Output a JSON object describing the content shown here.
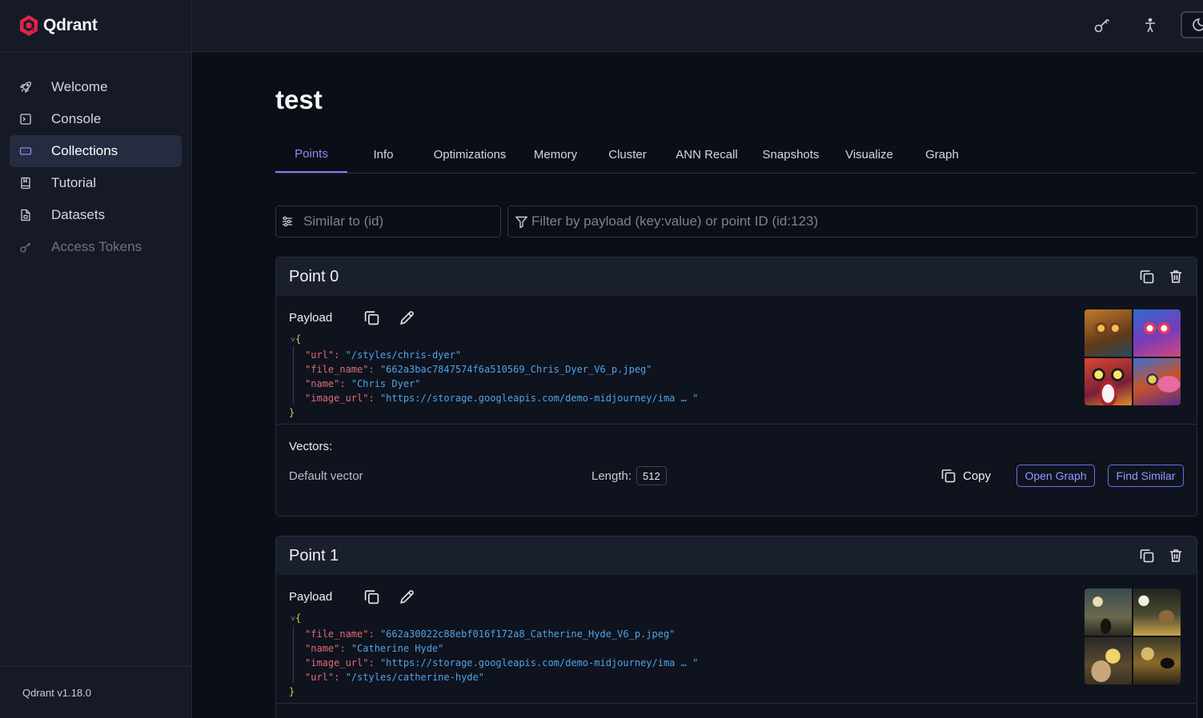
{
  "app": {
    "name": "Qdrant",
    "version": "Qdrant v1.18.0"
  },
  "sidebar": {
    "items": [
      {
        "label": "Welcome",
        "icon": "rocket-icon",
        "state": "normal"
      },
      {
        "label": "Console",
        "icon": "terminal-icon",
        "state": "normal"
      },
      {
        "label": "Collections",
        "icon": "collections-icon",
        "state": "active"
      },
      {
        "label": "Tutorial",
        "icon": "book-icon",
        "state": "normal"
      },
      {
        "label": "Datasets",
        "icon": "file-icon",
        "state": "normal"
      },
      {
        "label": "Access Tokens",
        "icon": "key-icon",
        "state": "disabled"
      }
    ]
  },
  "header": {
    "icons": [
      "key-icon",
      "accessibility-icon",
      "theme-toggle-icon"
    ]
  },
  "page": {
    "title": "test"
  },
  "tabs": [
    "Points",
    "Info",
    "Optimizations",
    "Memory",
    "Cluster",
    "ANN Recall",
    "Snapshots",
    "Visualize",
    "Graph"
  ],
  "active_tab": "Points",
  "search": {
    "similar_placeholder": "Similar to (id)",
    "filter_placeholder": "Filter by payload (key:value) or point ID (id:123)"
  },
  "labels": {
    "payload": "Payload",
    "vectors": "Vectors:",
    "default_vector": "Default vector",
    "length": "Length:",
    "copy": "Copy",
    "open_graph": "Open Graph",
    "find_similar": "Find Similar"
  },
  "points": [
    {
      "title": "Point 0",
      "payload": [
        {
          "key": "\"url\"",
          "value": "\"/styles/chris-dyer\""
        },
        {
          "key": "\"file_name\"",
          "value": "\"662a3bac7847574f6a510569_Chris_Dyer_V6_p.jpeg\""
        },
        {
          "key": "\"name\"",
          "value": "\"Chris Dyer\""
        },
        {
          "key": "\"image_url\"",
          "value": "\"https://storage.googleapis.com/demo-midjourney/ima … \""
        }
      ],
      "vector_length": "512"
    },
    {
      "title": "Point 1",
      "payload": [
        {
          "key": "\"file_name\"",
          "value": "\"662a30022c88ebf016f172a8_Catherine_Hyde_V6_p.jpeg\""
        },
        {
          "key": "\"name\"",
          "value": "\"Catherine Hyde\""
        },
        {
          "key": "\"image_url\"",
          "value": "\"https://storage.googleapis.com/demo-midjourney/ima … \""
        },
        {
          "key": "\"url\"",
          "value": "\"/styles/catherine-hyde\""
        }
      ]
    }
  ],
  "json_syntax": {
    "open": "{",
    "close": "}",
    "colon": ": ",
    "collapse": "˅"
  },
  "colors": {
    "accent": "#7b80ee",
    "json_key": "#e06c75",
    "json_value": "#4fa3e8",
    "brace": "#d9c44a",
    "logo": "#dc244c"
  }
}
